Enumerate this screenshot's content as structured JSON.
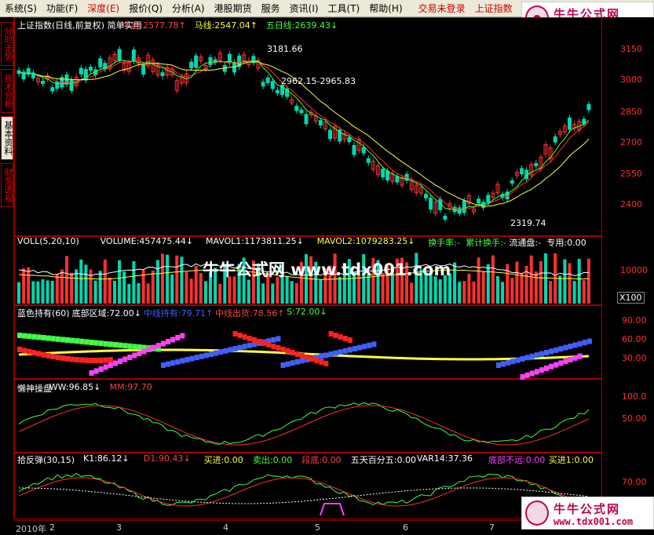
{
  "menu": {
    "items": [
      "系统(S)",
      "功能(F)",
      "深度(E)",
      "报价(Q)",
      "分析(A)",
      "港股期货",
      "服务",
      "资讯(I)",
      "工具(T)",
      "帮助(H)"
    ],
    "active_index": 2,
    "login_text": "交易未登录",
    "index_text": "上证指数"
  },
  "logo": {
    "name": "牛牛公式网",
    "url": "www.tdx001.com"
  },
  "sidetabs": [
    "分时走势",
    "技术分析",
    "基本资料",
    "财务透视"
  ],
  "sidetab_selected": 1,
  "watermark": "牛牛公式网 www.tdx001.com",
  "main_panel": {
    "header": [
      {
        "text": "上证指数(日线,前复权) 简单实用",
        "color": "#ffffff"
      },
      {
        "text": "牛线:2577.78↑",
        "color": "#ff4040"
      },
      {
        "text": "马线:2547.04↑",
        "color": "#ffff40"
      },
      {
        "text": "五日线:2639.43↓",
        "color": "#40ff40"
      }
    ],
    "annotations": [
      {
        "text": "3181.66",
        "color": "#ffffff"
      },
      {
        "text": "2962.15-2965.83",
        "color": "#ffffff"
      },
      {
        "text": "2319.74",
        "color": "#ffffff"
      }
    ],
    "y_ticks": [
      "3150",
      "3000",
      "2850",
      "2700",
      "2550",
      "2400"
    ]
  },
  "vol_panel": {
    "header": [
      {
        "text": "VOLL(5,20,10)",
        "color": "#ffffff"
      },
      {
        "text": "VOLUME:457475.44↓",
        "color": "#ffffff"
      },
      {
        "text": "MAVOL1:1173811.25↓",
        "color": "#ffffff"
      },
      {
        "text": "MAVOL2:1079283.25↓",
        "color": "#ffff40"
      },
      {
        "text": "换手率:-",
        "color": "#40ff40"
      },
      {
        "text": "累计换手:-",
        "color": "#40ff40"
      },
      {
        "text": "流通盘:-",
        "color": "#ffffff"
      },
      {
        "text": "专用:0.00",
        "color": "#ffffff"
      }
    ],
    "y_ticks": [
      "10000"
    ],
    "unit": "X100"
  },
  "blue_panel": {
    "header": [
      {
        "text": "蓝色持有(60)",
        "color": "#ffffff"
      },
      {
        "text": "底部区域:72.00↓",
        "color": "#ffffff"
      },
      {
        "text": "中线持有:79.71↑",
        "color": "#4060ff"
      },
      {
        "text": "中线出货:78.56↑",
        "color": "#ff4040"
      },
      {
        "text": "S:72.00↓",
        "color": "#40ff40"
      }
    ],
    "y_ticks": [
      "90.00",
      "60.00",
      "30.00"
    ]
  },
  "lazy_panel": {
    "header": [
      {
        "text": "懒神操盘",
        "color": "#ffffff"
      },
      {
        "text": "WW:96.85↓",
        "color": "#ffffff"
      },
      {
        "text": "MM:97.70",
        "color": "#ff4040"
      }
    ],
    "y_ticks": [
      "100.0",
      "50.00"
    ]
  },
  "rebound_panel": {
    "header": [
      {
        "text": "拾反弹(30,15)",
        "color": "#ffffff"
      },
      {
        "text": "K1:86.12↓",
        "color": "#ffffff"
      },
      {
        "text": "D1:90.43↓",
        "color": "#ff4040"
      },
      {
        "text": "买进:0.00",
        "color": "#ffff40"
      },
      {
        "text": "卖出:0.00",
        "color": "#40ff40"
      },
      {
        "text": "段底:0.00",
        "color": "#ff4040"
      },
      {
        "text": "五天百分五:0.00",
        "color": "#ffffff"
      },
      {
        "text": "VAR14:37.36",
        "color": "#ffffff"
      },
      {
        "text": "底部不远:0.00",
        "color": "#ff40ff"
      },
      {
        "text": "买进1:0.00",
        "color": "#ffff40"
      }
    ],
    "y_ticks": [
      "70.00"
    ]
  },
  "time_axis": [
    "2010年",
    "2",
    "3",
    "4",
    "5",
    "6",
    "7"
  ]
}
